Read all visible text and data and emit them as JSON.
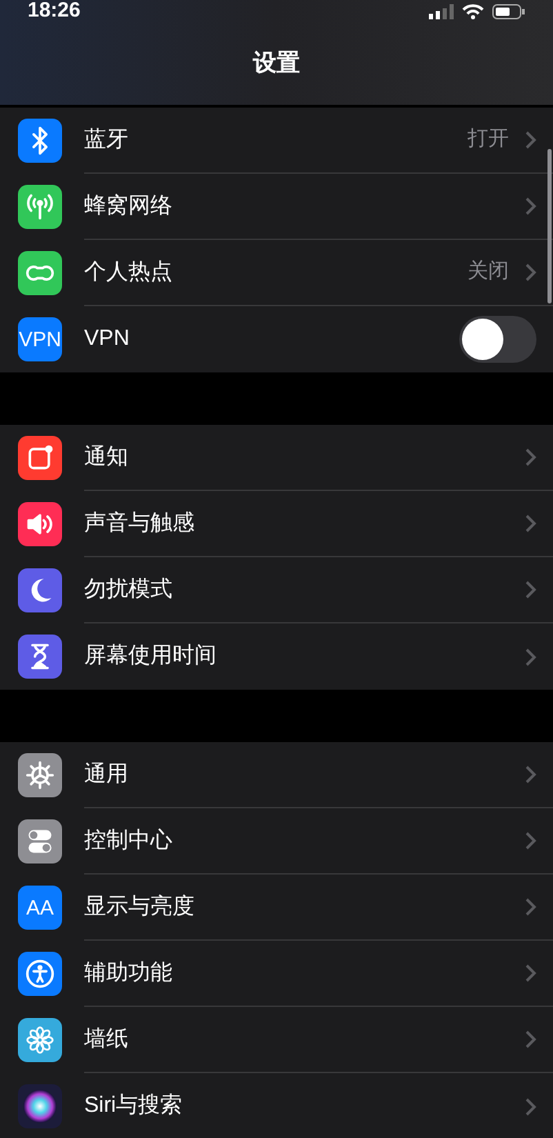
{
  "status_bar": {
    "time": "18:26"
  },
  "title": "设置",
  "groups": [
    {
      "items": [
        {
          "kind": "link",
          "color": "#0a7aff",
          "label": "蓝牙",
          "value": "打开"
        },
        {
          "kind": "link",
          "color": "#31c759",
          "label": "蜂窝网络"
        },
        {
          "kind": "link",
          "color": "#31c759",
          "label": "个人热点",
          "value": "关闭"
        },
        {
          "kind": "toggle",
          "icon_text": "VPN",
          "color": "#0a7aff",
          "label": "VPN",
          "on": false
        }
      ]
    },
    {
      "items": [
        {
          "kind": "link",
          "color": "#ff3b30",
          "label": "通知"
        },
        {
          "kind": "link",
          "color": "#ff2d55",
          "label": "声音与触感"
        },
        {
          "kind": "link",
          "color": "#5e5ce6",
          "label": "勿扰模式"
        },
        {
          "kind": "link",
          "color": "#5e5ce6",
          "label": "屏幕使用时间"
        }
      ]
    },
    {
      "items": [
        {
          "kind": "link",
          "color": "#8e8e93",
          "label": "通用"
        },
        {
          "kind": "link",
          "color": "#8e8e93",
          "label": "控制中心"
        },
        {
          "kind": "link",
          "icon_text": "AA",
          "color": "#0a7aff",
          "label": "显示与亮度"
        },
        {
          "kind": "link",
          "color": "#0a7aff",
          "label": "辅助功能"
        },
        {
          "kind": "link",
          "color": "#35aadc",
          "label": "墙纸"
        },
        {
          "kind": "link",
          "color": "#1c1c3a",
          "label": "Siri与搜索"
        }
      ]
    }
  ]
}
